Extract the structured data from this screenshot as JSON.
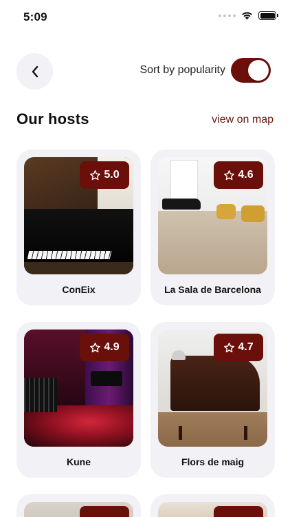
{
  "status_bar": {
    "time": "5:09"
  },
  "header": {
    "sort_label": "Sort by popularity",
    "sort_enabled": true
  },
  "section": {
    "title": "Our hosts",
    "map_link": "view on map"
  },
  "colors": {
    "accent": "#6b0f0b",
    "card_bg": "#f2f1f6",
    "link": "#6b160f"
  },
  "hosts": [
    {
      "name": "ConEix",
      "rating": "5.0",
      "image": "piano-room-photo"
    },
    {
      "name": "La Sala de Barcelona",
      "rating": "4.6",
      "image": "piano-room-photo"
    },
    {
      "name": "Kune",
      "rating": "4.9",
      "image": "stage-photo"
    },
    {
      "name": "Flors de maig",
      "rating": "4.7",
      "image": "piano-room-photo"
    }
  ]
}
